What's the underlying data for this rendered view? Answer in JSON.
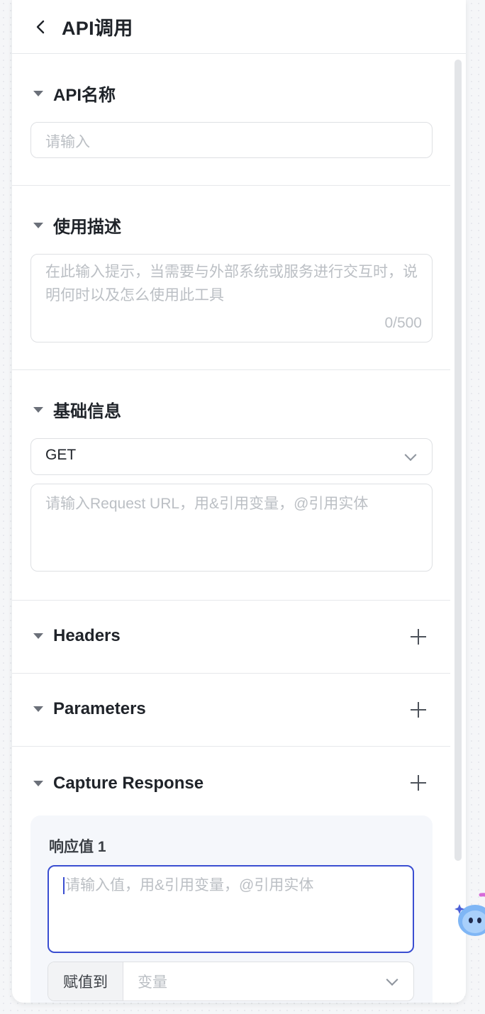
{
  "header": {
    "title": "API调用"
  },
  "sections": {
    "api_name": {
      "title": "API名称",
      "placeholder": "请输入"
    },
    "usage": {
      "title": "使用描述",
      "placeholder": "在此输入提示，当需要与外部系统或服务进行交互时，说明何时以及怎么使用此工具",
      "counter": "0/500"
    },
    "basic": {
      "title": "基础信息",
      "method": "GET",
      "url_placeholder": "请输入Request URL，用&引用变量，@引用实体"
    },
    "headers": {
      "title": "Headers"
    },
    "parameters": {
      "title": "Parameters"
    },
    "capture": {
      "title": "Capture Response",
      "item_label": "响应值 1",
      "value_placeholder": "请输入值，用&引用变量，@引用实体",
      "assign_label": "赋值到",
      "assign_placeholder": "变量"
    }
  },
  "colors": {
    "accent": "#3a4ed1",
    "panel": "#ffffff",
    "card": "#f5f7fb"
  }
}
